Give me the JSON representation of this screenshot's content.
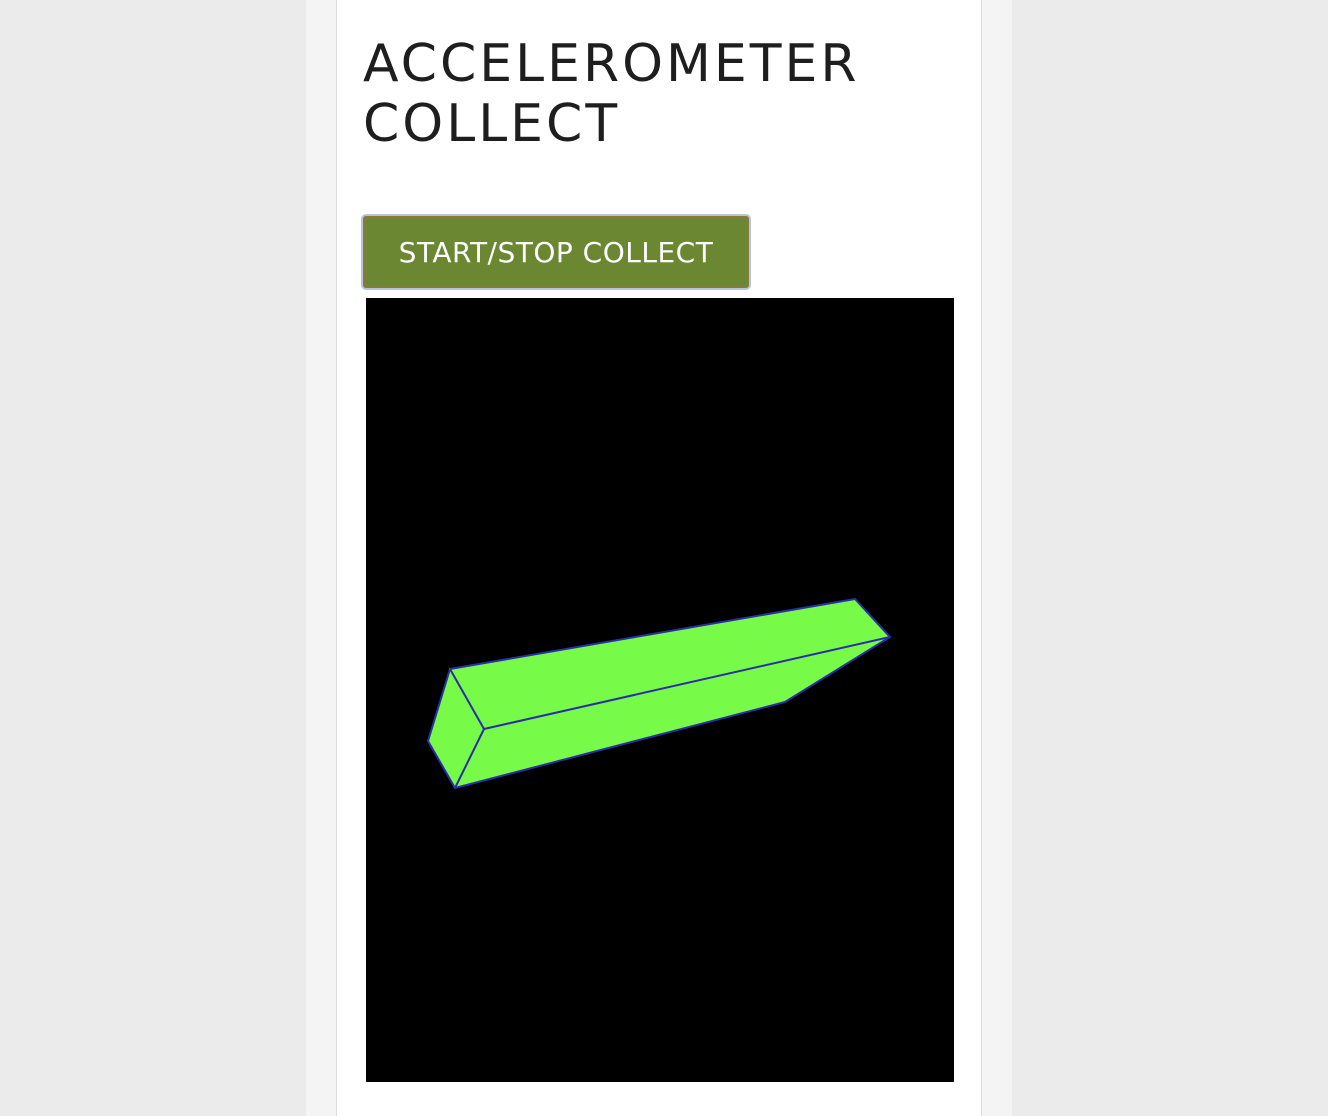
{
  "page": {
    "title_line1": "ACCELEROMETER",
    "title_line2": "COLLECT"
  },
  "controls": {
    "collect_label": "START/STOP COLLECT"
  },
  "viewport": {
    "background_color": "#000000",
    "object_color": "#77fb48",
    "edge_color": "#2a2fa8"
  },
  "colors": {
    "button_background": "#6b8731",
    "page_background": "#ebebeb"
  }
}
